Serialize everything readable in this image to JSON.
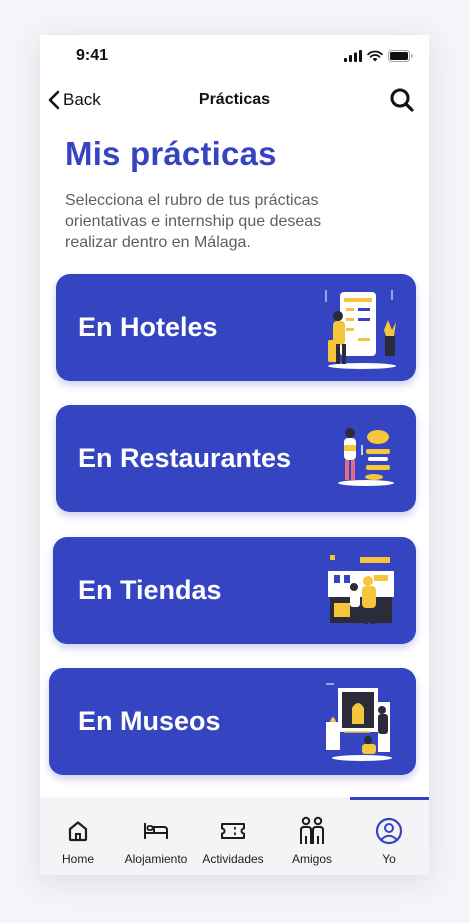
{
  "status": {
    "time": "9:41"
  },
  "nav": {
    "back_label": "Back",
    "title": "Prácticas"
  },
  "header": {
    "title": "Mis prácticas",
    "subtitle": "Selecciona el rubro de tus prácticas orientativas e internship que deseas realizar dentro en Málaga."
  },
  "cards": [
    {
      "label": "En Hoteles",
      "illustration": "hotel-illustration"
    },
    {
      "label": "En Restaurantes",
      "illustration": "restaurant-illustration"
    },
    {
      "label": "En Tiendas",
      "illustration": "store-illustration"
    },
    {
      "label": "En Museos",
      "illustration": "museum-illustration"
    }
  ],
  "tabbar": {
    "active": "Yo",
    "items": [
      {
        "label": "Home",
        "icon": "home-icon"
      },
      {
        "label": "Alojamiento",
        "icon": "bed-icon"
      },
      {
        "label": "Actividades",
        "icon": "ticket-icon"
      },
      {
        "label": "Amigos",
        "icon": "friends-icon"
      },
      {
        "label": "Yo",
        "icon": "profile-icon"
      }
    ]
  },
  "colors": {
    "accent": "#3544c1",
    "illustration_yellow": "#f5c53c",
    "text_gray": "#5e5e64"
  }
}
